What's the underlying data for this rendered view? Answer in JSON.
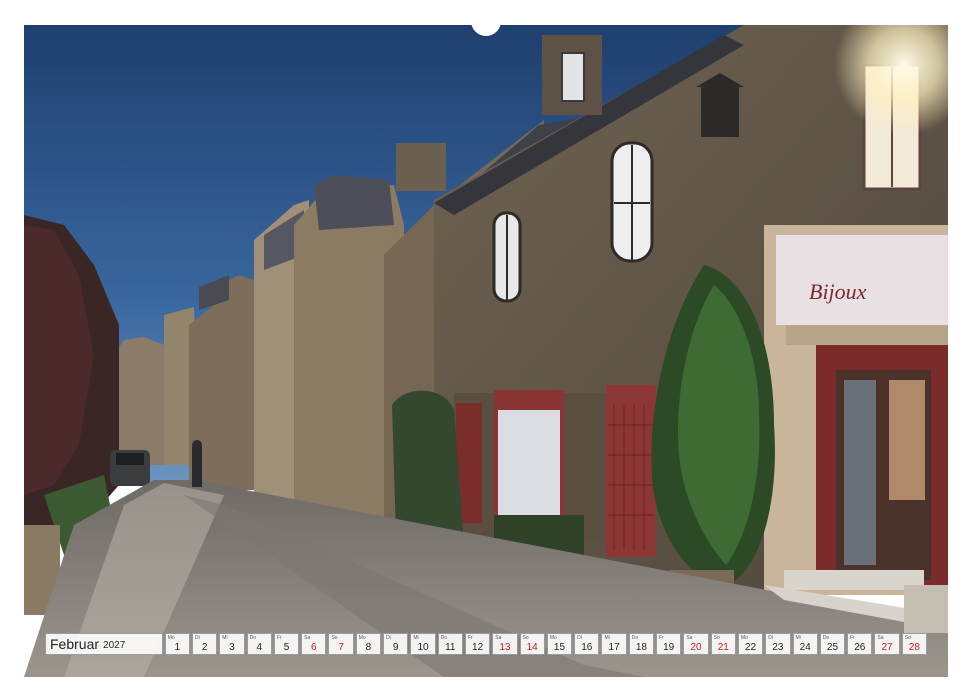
{
  "photo": {
    "shop_sign": "Bijoux"
  },
  "calendar": {
    "month": "Februar",
    "year": "2027",
    "days": [
      {
        "wd": "Mo",
        "num": "1",
        "weekend": false
      },
      {
        "wd": "Di",
        "num": "2",
        "weekend": false
      },
      {
        "wd": "Mi",
        "num": "3",
        "weekend": false
      },
      {
        "wd": "Do",
        "num": "4",
        "weekend": false
      },
      {
        "wd": "Fr",
        "num": "5",
        "weekend": false
      },
      {
        "wd": "Sa",
        "num": "6",
        "weekend": true
      },
      {
        "wd": "So",
        "num": "7",
        "weekend": true
      },
      {
        "wd": "Mo",
        "num": "8",
        "weekend": false
      },
      {
        "wd": "Di",
        "num": "9",
        "weekend": false
      },
      {
        "wd": "Mi",
        "num": "10",
        "weekend": false
      },
      {
        "wd": "Do",
        "num": "11",
        "weekend": false
      },
      {
        "wd": "Fr",
        "num": "12",
        "weekend": false
      },
      {
        "wd": "Sa",
        "num": "13",
        "weekend": true
      },
      {
        "wd": "So",
        "num": "14",
        "weekend": true
      },
      {
        "wd": "Mo",
        "num": "15",
        "weekend": false
      },
      {
        "wd": "Di",
        "num": "16",
        "weekend": false
      },
      {
        "wd": "Mi",
        "num": "17",
        "weekend": false
      },
      {
        "wd": "Do",
        "num": "18",
        "weekend": false
      },
      {
        "wd": "Fr",
        "num": "19",
        "weekend": false
      },
      {
        "wd": "Sa",
        "num": "20",
        "weekend": true
      },
      {
        "wd": "So",
        "num": "21",
        "weekend": true
      },
      {
        "wd": "Mo",
        "num": "22",
        "weekend": false
      },
      {
        "wd": "Di",
        "num": "23",
        "weekend": false
      },
      {
        "wd": "Mi",
        "num": "24",
        "weekend": false
      },
      {
        "wd": "Do",
        "num": "25",
        "weekend": false
      },
      {
        "wd": "Fr",
        "num": "26",
        "weekend": false
      },
      {
        "wd": "Sa",
        "num": "27",
        "weekend": true
      },
      {
        "wd": "So",
        "num": "28",
        "weekend": true
      }
    ]
  }
}
